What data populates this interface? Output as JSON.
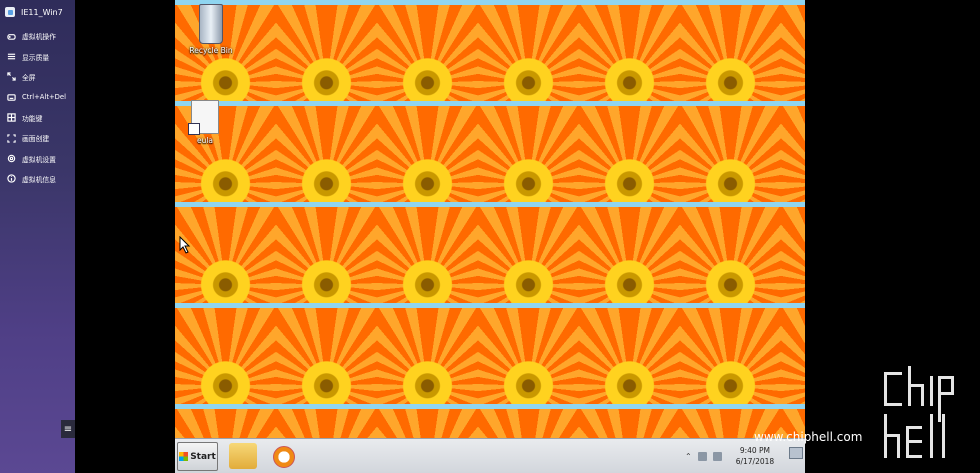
{
  "vm": {
    "title": "IE11_Win7"
  },
  "sidebar": {
    "items": [
      {
        "label": "虚拟机操作",
        "icon": "gamepad-icon"
      },
      {
        "label": "显示质量",
        "icon": "sliders-icon"
      },
      {
        "label": "全屏",
        "icon": "fullscreen-icon"
      },
      {
        "label": "Ctrl+Alt+Del",
        "icon": "keyboard-icon"
      },
      {
        "label": "功能键",
        "icon": "grid-icon"
      },
      {
        "label": "画面创建",
        "icon": "frame-icon"
      },
      {
        "label": "虚拟机设置",
        "icon": "gear-icon"
      },
      {
        "label": "虚拟机信息",
        "icon": "info-icon"
      }
    ]
  },
  "desktop": {
    "icons": [
      {
        "label": "Recycle Bin"
      },
      {
        "label": "eula"
      }
    ]
  },
  "taskbar": {
    "start_label": "Start",
    "time": "9:40 PM",
    "date": "6/17/2018"
  },
  "watermark": {
    "site": "www.chiphell.com",
    "logo_text": "chiphell"
  }
}
